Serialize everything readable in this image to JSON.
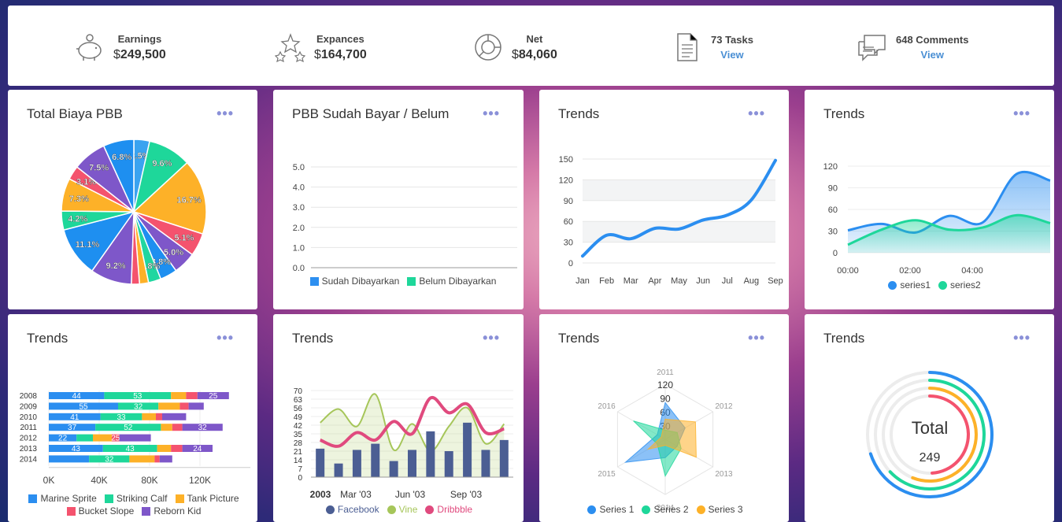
{
  "stats": {
    "earnings": {
      "label": "Earnings",
      "currency": "$",
      "value": "249,500",
      "icon": "piggy-bank-icon"
    },
    "expances": {
      "label": "Expances",
      "currency": "$",
      "value": "164,700",
      "icon": "sparkle-stars-icon"
    },
    "net": {
      "label": "Net",
      "currency": "$",
      "value": "84,060",
      "icon": "donut-chart-icon"
    },
    "tasks": {
      "label": "73 Tasks",
      "link": "View",
      "icon": "document-icon"
    },
    "comments": {
      "label": "648 Comments",
      "link": "View",
      "icon": "chat-bubbles-icon"
    }
  },
  "cards": {
    "pie": {
      "title": "Total Biaya PBB",
      "more": "•••"
    },
    "pbb": {
      "title": "PBB Sudah Bayar / Belum",
      "more": "•••"
    },
    "line": {
      "title": "Trends",
      "more": "•••"
    },
    "area": {
      "title": "Trends",
      "more": "•••"
    },
    "hbar": {
      "title": "Trends",
      "more": "•••"
    },
    "combo": {
      "title": "Trends",
      "more": "•••"
    },
    "radar": {
      "title": "Trends",
      "more": "•••"
    },
    "radial": {
      "title": "Trends",
      "more": "•••"
    }
  },
  "chart_data": [
    {
      "id": "pie",
      "type": "pie",
      "slices": [
        {
          "value": 3.5,
          "label": "3.5%",
          "color": "#3aa3f0"
        },
        {
          "value": 9.6,
          "label": "9.6%",
          "color": "#1ed79a"
        },
        {
          "value": 16.7,
          "label": "16.7%",
          "color": "#fdb128"
        },
        {
          "value": 5.1,
          "label": "5.1%",
          "color": "#f4536e"
        },
        {
          "value": 5.0,
          "label": "5.0%",
          "color": "#7e57c9"
        },
        {
          "value": 3.8,
          "label": "3.8%",
          "color": "#1e8ff0"
        },
        {
          "value": 2.8,
          "label": "2.8%",
          "color": "#20d6a0"
        },
        {
          "value": 2.0,
          "label": "",
          "color": "#fdb128"
        },
        {
          "value": 1.8,
          "label": "",
          "color": "#f4536e"
        },
        {
          "value": 9.2,
          "label": "9.2%",
          "color": "#7e57c9"
        },
        {
          "value": 11.1,
          "label": "11.1%",
          "color": "#1e8ff0"
        },
        {
          "value": 4.2,
          "label": "4.2%",
          "color": "#1ed79a"
        },
        {
          "value": 7.3,
          "label": "7.3%",
          "color": "#fdb128"
        },
        {
          "value": 3.1,
          "label": "3.1%",
          "color": "#f4536e"
        },
        {
          "value": 7.5,
          "label": "7.5%",
          "color": "#7e57c9"
        },
        {
          "value": 6.8,
          "label": "6.8%",
          "color": "#1e8ff0"
        }
      ]
    },
    {
      "id": "pbb",
      "type": "bar",
      "categories": [],
      "yticks": [
        "5.0",
        "4.0",
        "3.0",
        "2.0",
        "1.0",
        "0.0"
      ],
      "ylim": [
        0,
        5
      ],
      "series": [
        {
          "name": "Sudah Dibayarkan",
          "values": [],
          "color": "#2d8ff0"
        },
        {
          "name": "Belum Dibayarkan",
          "values": [],
          "color": "#1ed79a"
        }
      ]
    },
    {
      "id": "line",
      "type": "line",
      "x": [
        "Jan",
        "Feb",
        "Mar",
        "Apr",
        "May",
        "Jun",
        "Jul",
        "Aug",
        "Sep"
      ],
      "yticks": [
        "150",
        "120",
        "90",
        "60",
        "30",
        "0"
      ],
      "ylim": [
        0,
        150
      ],
      "series": [
        {
          "values": [
            10,
            40,
            35,
            50,
            49,
            62,
            69,
            91,
            148
          ],
          "color": "#2b8ef0"
        }
      ]
    },
    {
      "id": "area",
      "type": "area",
      "xticks": [
        "00:00",
        "02:00",
        "04:00"
      ],
      "yticks": [
        "120",
        "90",
        "60",
        "30",
        "0"
      ],
      "ylim": [
        0,
        120
      ],
      "series": [
        {
          "name": "series1",
          "values": [
            31,
            40,
            28,
            51,
            42,
            109,
            100
          ],
          "color": "#2b8ef0"
        },
        {
          "name": "series2",
          "values": [
            11,
            32,
            45,
            32,
            35,
            52,
            41
          ],
          "color": "#1ed79a"
        }
      ]
    },
    {
      "id": "hbar",
      "type": "bar",
      "orientation": "horizontal",
      "stacked": true,
      "categories": [
        "2008",
        "2009",
        "2010",
        "2011",
        "2012",
        "2013",
        "2014"
      ],
      "xticks": [
        "0K",
        "40K",
        "80K",
        "120K"
      ],
      "xlim": [
        0,
        160000
      ],
      "series": [
        {
          "name": "Marine Sprite",
          "values": [
            44,
            55,
            41,
            37,
            22,
            43,
            32
          ],
          "color": "#2b8ef0"
        },
        {
          "name": "Striking Calf",
          "values": [
            53,
            32,
            33,
            52,
            13,
            43,
            32
          ],
          "color": "#1ed79a"
        },
        {
          "name": "Tank Picture",
          "values": [
            12,
            17,
            11,
            9,
            15,
            11,
            20
          ],
          "color": "#fdb128"
        },
        {
          "name": "Bucket Slope",
          "values": [
            9,
            7,
            5,
            8,
            6,
            9,
            4
          ],
          "color": "#f4536e"
        },
        {
          "name": "Reborn Kid",
          "values": [
            25,
            12,
            19,
            32,
            25,
            24,
            10
          ],
          "color": "#7e57c9"
        }
      ],
      "bar_labels": [
        [
          "44",
          "53",
          "",
          "",
          "25"
        ],
        [
          "55",
          "32",
          "",
          "",
          ""
        ],
        [
          "41",
          "33",
          "",
          "",
          ""
        ],
        [
          "37",
          "52",
          "",
          "",
          "32"
        ],
        [
          "22",
          "",
          "",
          "25",
          ""
        ],
        [
          "43",
          "43",
          "",
          "",
          "24"
        ],
        [
          "",
          "32",
          "",
          "",
          ""
        ]
      ]
    },
    {
      "id": "combo",
      "type": "bar",
      "xticks": [
        "2003",
        "Mar '03",
        "Jun '03",
        "Sep '03"
      ],
      "yticks": [
        "70",
        "63",
        "56",
        "49",
        "42",
        "35",
        "28",
        "21",
        "14",
        "7",
        "0"
      ],
      "ylim": [
        0,
        70
      ],
      "series": [
        {
          "name": "Facebook",
          "kind": "column",
          "values": [
            23,
            11,
            22,
            27,
            13,
            22,
            37,
            21,
            44,
            22,
            30
          ],
          "color": "#4b5e93"
        },
        {
          "name": "Vine",
          "kind": "area",
          "values": [
            44,
            55,
            41,
            67,
            22,
            43,
            21,
            41,
            56,
            27,
            43
          ],
          "color": "#a6c65a"
        },
        {
          "name": "Dribbble",
          "kind": "line",
          "values": [
            30,
            25,
            36,
            30,
            45,
            35,
            64,
            52,
            59,
            36,
            39
          ],
          "color": "#e04a7e"
        }
      ]
    },
    {
      "id": "radar",
      "type": "radar",
      "axes": [
        "2011",
        "2012",
        "2013",
        "2014",
        "2015",
        "2016"
      ],
      "rticks": [
        "120",
        "90",
        "60",
        "30",
        "0"
      ],
      "rlim": [
        0,
        120
      ],
      "series": [
        {
          "name": "Series 1",
          "values": [
            80,
            50,
            30,
            40,
            100,
            20
          ],
          "color": "#2b8ef0"
        },
        {
          "name": "Series 2",
          "values": [
            20,
            30,
            40,
            80,
            20,
            80
          ],
          "color": "#1ed79a"
        },
        {
          "name": "Series 3",
          "values": [
            44,
            76,
            78,
            13,
            43,
            10
          ],
          "color": "#fdb128"
        }
      ]
    },
    {
      "id": "radial",
      "type": "radialBar",
      "total_label": "Total",
      "total_value": "249",
      "series": [
        {
          "value": 70,
          "color": "#2b8ef0"
        },
        {
          "value": 63,
          "color": "#1ed79a"
        },
        {
          "value": 56,
          "color": "#fdb128"
        },
        {
          "value": 49,
          "color": "#f4536e"
        }
      ]
    }
  ]
}
